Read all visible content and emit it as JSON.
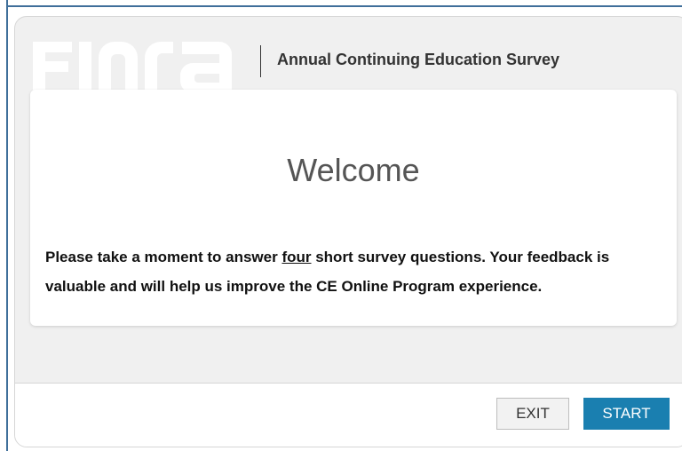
{
  "header": {
    "logo_text": "FINRA",
    "title": "Annual Continuing Education Survey"
  },
  "card": {
    "title": "Welcome",
    "text_before": "Please take a moment to answer ",
    "text_underlined": "four",
    "text_after": " short survey questions. Your feedback is valuable and will help us improve the CE Online Program experience."
  },
  "footer": {
    "exit_label": "EXIT",
    "start_label": "START"
  },
  "colors": {
    "primary_button": "#1a7fb0",
    "background": "#f0f0f0"
  }
}
